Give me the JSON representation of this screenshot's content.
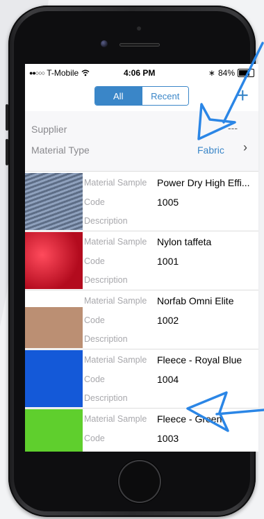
{
  "status_bar": {
    "signal": "●●○○○",
    "carrier": "T-Mobile",
    "wifi_icon": "wifi-icon",
    "time": "4:06 PM",
    "bluetooth": "∗",
    "battery_percent": "84%",
    "battery_level": 0.84
  },
  "nav": {
    "segments": [
      "All",
      "Recent"
    ],
    "selected": "All",
    "add_label": "+"
  },
  "filters": {
    "supplier_label": "Supplier",
    "supplier_value": "---",
    "material_type_label": "Material Type",
    "material_type_value": "Fabric",
    "chevron": "›"
  },
  "field_labels": {
    "sample": "Material Sample",
    "code": "Code",
    "description": "Description"
  },
  "materials": [
    {
      "name": "Power Dry High Effi...",
      "code": "1005",
      "swatch": "#7b8aa3"
    },
    {
      "name": "Nylon taffeta",
      "code": "1001",
      "swatch": "#d9182c"
    },
    {
      "name": "Norfab Omni Elite",
      "code": "1002",
      "swatch": "#bb8f73"
    },
    {
      "name": "Fleece - Royal Blue",
      "code": "1004",
      "swatch": "#1459d8"
    },
    {
      "name": "Fleece - Green",
      "code": "1003",
      "swatch": "#5fcf2d"
    }
  ],
  "colors": {
    "accent": "#3a86c8",
    "annotation_arrow": "#2b86e6"
  }
}
